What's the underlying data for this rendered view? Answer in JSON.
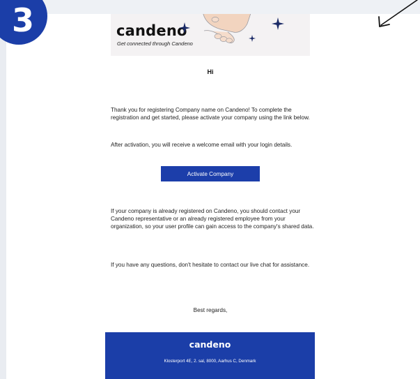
{
  "step": {
    "number": "3"
  },
  "banner": {
    "brand": "candeno",
    "tagline": "Get connected through Candeno"
  },
  "email": {
    "greeting": "Hi",
    "intro_line1": "Thank you for registering Company name on Candeno! To complete the",
    "intro_line2": "registration and get started, please activate your company using the link below.",
    "after_activation": "After activation, you will receive a welcome email with your login details.",
    "activate_button_label": "Activate Company",
    "registered_line1": "If your company is already registered on Candeno, you should contact your",
    "registered_line2": "Candeno representative or an already registered employee from your",
    "registered_line3": "organization, so your user profile can gain access to the company's shared data.",
    "questions": "If you have any questions, don't hesitate to contact our live chat for assistance.",
    "regards": "Best regards,"
  },
  "footer": {
    "brand": "candeno",
    "address": "Klosterport 4E, 2. sal, 8000, Aarhus C, Denmark"
  },
  "icons": {
    "arrow": "arrow-down-left-icon",
    "stars": "sparkle-star-icon",
    "hands": "handshake-icon"
  },
  "colors": {
    "brand_blue": "#1b3ea8",
    "banner_bg": "#f4f2f3",
    "star_navy": "#1a2a66",
    "hand_skin": "#f2d4bf"
  }
}
